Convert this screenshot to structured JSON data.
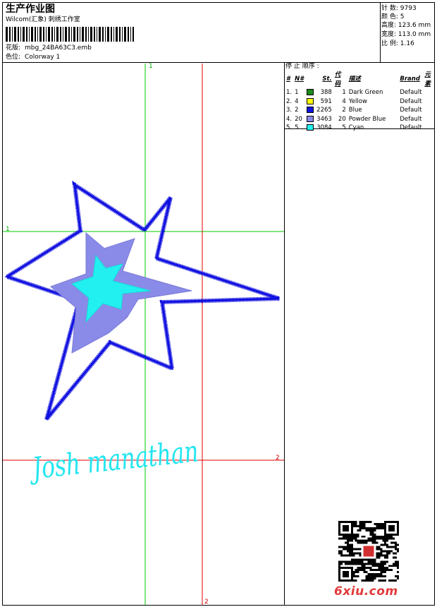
{
  "header": {
    "title": "生产作业图",
    "company": "Wilcom(汇象) 刺绣工作室",
    "design_file_label": "花版:",
    "design_file": "mbg_24BA63C3.emb",
    "colorway_label": "色位:",
    "colorway": "Colorway 1"
  },
  "meta": {
    "stitches_label": "针 数:",
    "stitches": "9793",
    "colors_label": "颜 色:",
    "colors": "5",
    "height_label": "高度:",
    "height": "123.6 mm",
    "width_label": "宽度:",
    "width": "113.0 mm",
    "scale_label": "比 例:",
    "scale": "1.16"
  },
  "stop_sequence": {
    "title": "停 止 顺序 :",
    "headers": [
      "#",
      "N#",
      "St.",
      "代码",
      "描述",
      "Brand",
      "元素"
    ],
    "rows": [
      {
        "idx": "1.",
        "n": "1",
        "color": "#1a8c1a",
        "st": "388",
        "code": "1",
        "desc": "Dark Green",
        "brand": "Default"
      },
      {
        "idx": "2.",
        "n": "4",
        "color": "#ffff00",
        "st": "591",
        "code": "4",
        "desc": "Yellow",
        "brand": "Default"
      },
      {
        "idx": "3.",
        "n": "2",
        "color": "#1010e0",
        "st": "2265",
        "code": "2",
        "desc": "Blue",
        "brand": "Default"
      },
      {
        "idx": "4.",
        "n": "20",
        "color": "#8a8ae8",
        "st": "3463",
        "code": "20",
        "desc": "Powder Blue",
        "brand": "Default"
      },
      {
        "idx": "5.",
        "n": "5",
        "color": "#22f0f0",
        "st": "3084",
        "code": "5",
        "desc": "Cyan",
        "brand": "Default"
      }
    ]
  },
  "design": {
    "signature": "Josh manathan",
    "guide_top": "1",
    "guide_left": "1",
    "guide_right": "2",
    "guide_bottom": "2"
  },
  "watermark": "6xiu.com",
  "colors_map": {
    "blue": "#1010e0",
    "powder_blue": "#8a8ae8",
    "cyan": "#22f0f0",
    "guide_green": "#00cc00",
    "guide_red": "#e00000"
  }
}
